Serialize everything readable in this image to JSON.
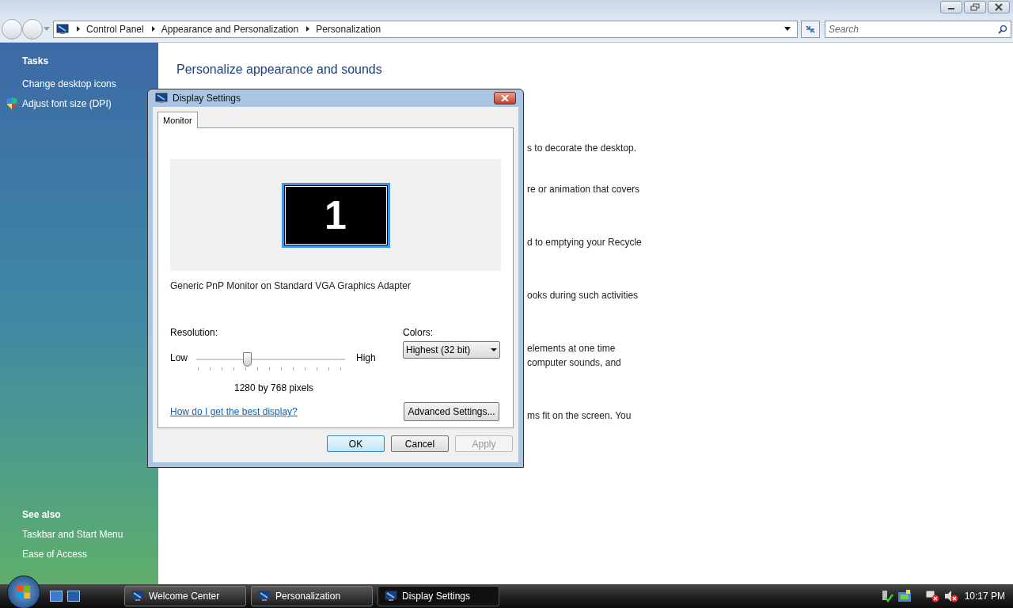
{
  "address_bar": {
    "crumbs": [
      "Control Panel",
      "Appearance and Personalization",
      "Personalization"
    ]
  },
  "search": {
    "placeholder": "Search"
  },
  "sidebar": {
    "tasks_heading": "Tasks",
    "tasks": [
      {
        "label": "Change desktop icons",
        "kind": "link"
      },
      {
        "label": "Adjust font size (DPI)",
        "kind": "shield"
      }
    ],
    "see_also_heading": "See also",
    "see_also": [
      "Taskbar and Start Menu",
      "Ease of Access"
    ]
  },
  "content": {
    "heading": "Personalize appearance and sounds",
    "fragments": [
      "s to decorate the desktop.",
      "re or animation that covers",
      "d to emptying your Recycle",
      "ooks during such activities",
      "elements at one time",
      "computer sounds, and",
      "ms fit on the screen. You"
    ]
  },
  "dialog": {
    "title": "Display Settings",
    "tabs": [
      {
        "label": "Monitor",
        "selected": true
      }
    ],
    "monitor_number": "1",
    "monitor_name": "Generic PnP Monitor on Standard VGA Graphics Adapter",
    "resolution": {
      "label": "Resolution:",
      "low": "Low",
      "high": "High",
      "level": 0.34,
      "reading": "1280 by 768 pixels"
    },
    "colors": {
      "label": "Colors:",
      "value": "Highest (32 bit)"
    },
    "help_link": "How do I get the best display?",
    "advanced_button": "Advanced Settings...",
    "buttons": [
      {
        "label": "OK",
        "default": true,
        "disabled": false
      },
      {
        "label": "Cancel",
        "default": false,
        "disabled": false
      },
      {
        "label": "Apply",
        "default": false,
        "disabled": true
      }
    ]
  },
  "taskbar": {
    "items": [
      {
        "label": "Welcome Center",
        "selected": false
      },
      {
        "label": "Personalization",
        "selected": false
      },
      {
        "label": "Display Settings",
        "selected": true
      }
    ],
    "clock": "10:17 PM"
  }
}
